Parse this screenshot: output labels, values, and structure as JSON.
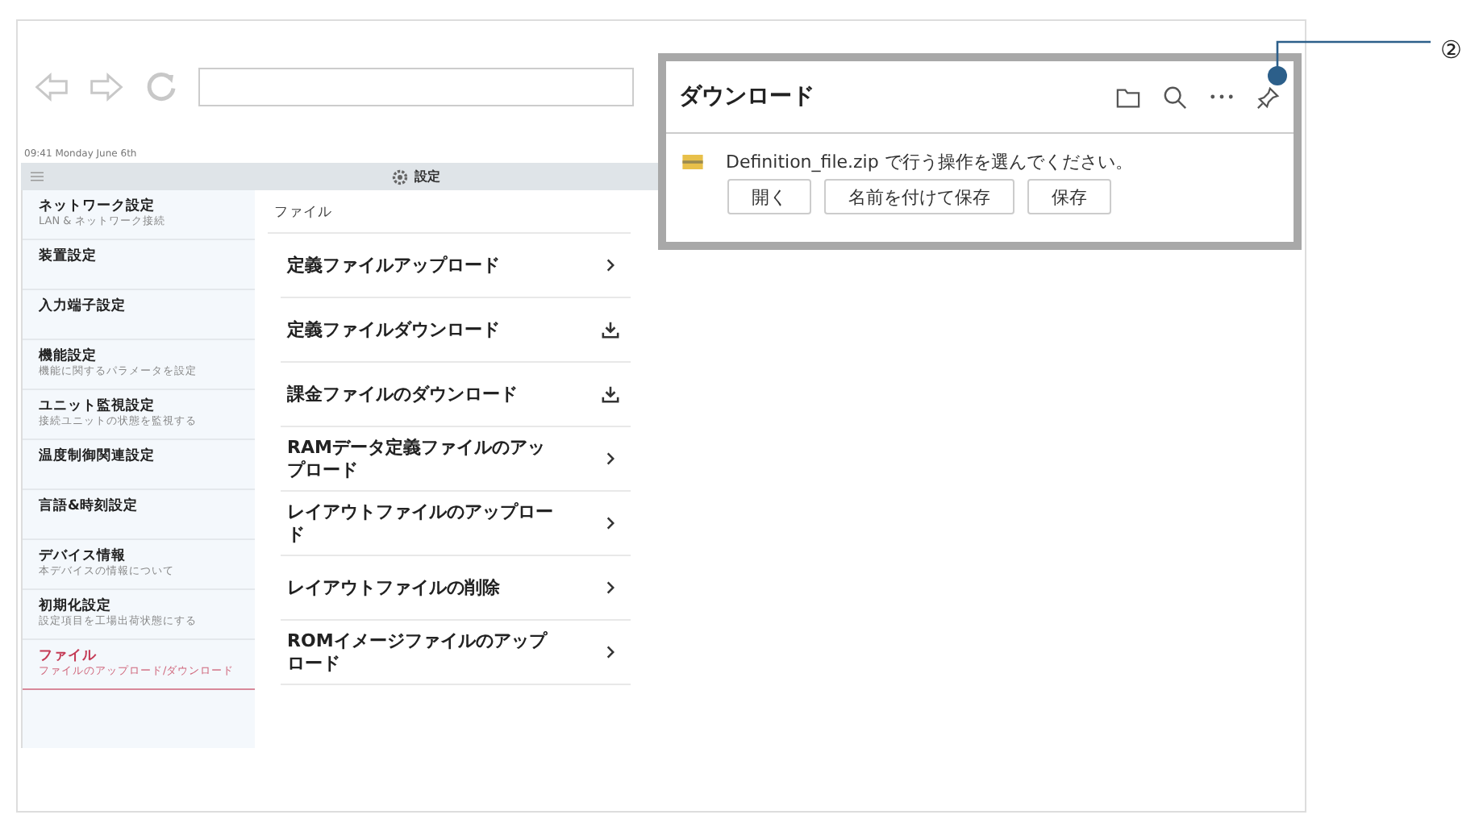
{
  "status_bar": {
    "text": "09:41 Monday June 6th"
  },
  "header": {
    "title": "設定"
  },
  "sidebar": {
    "items": [
      {
        "label": "ネットワーク設定",
        "subtitle": "LAN & ネットワーク接続",
        "selected": false
      },
      {
        "label": "装置設定",
        "selected": false
      },
      {
        "label": "入力端子設定",
        "selected": false
      },
      {
        "label": "機能設定",
        "subtitle": "機能に関するパラメータを設定",
        "selected": false
      },
      {
        "label": "ユニット監視設定",
        "subtitle": "接続ユニットの状態を監視する",
        "selected": false
      },
      {
        "label": "温度制御関連設定",
        "selected": false
      },
      {
        "label": "言語&時刻設定",
        "selected": false
      },
      {
        "label": "デバイス情報",
        "subtitle": "本デバイスの情報について",
        "selected": false
      },
      {
        "label": "初期化設定",
        "subtitle": "設定項目を工場出荷状態にする",
        "selected": false
      },
      {
        "label": "ファイル",
        "subtitle": "ファイルのアップロード/ダウンロード",
        "selected": true
      }
    ]
  },
  "content": {
    "heading": "ファイル",
    "items": [
      {
        "label": "定義ファイルアップロード",
        "kind": "chevron"
      },
      {
        "label": "定義ファイルダウンロード",
        "kind": "download"
      },
      {
        "label": "課金ファイルのダウンロード",
        "kind": "download"
      },
      {
        "label": "RAMデータ定義ファイルのアップロード",
        "kind": "chevron"
      },
      {
        "label": "レイアウトファイルのアップロード",
        "kind": "chevron"
      },
      {
        "label": "レイアウトファイルの削除",
        "kind": "chevron"
      },
      {
        "label": "ROMイメージファイルのアップロード",
        "kind": "chevron"
      }
    ]
  },
  "download_panel": {
    "title": "ダウンロード",
    "message": "Definition_file.zip で行う操作を選んでください。",
    "buttons": [
      "開く",
      "名前を付けて保存",
      "保存"
    ]
  },
  "callout": {
    "label": "②"
  }
}
